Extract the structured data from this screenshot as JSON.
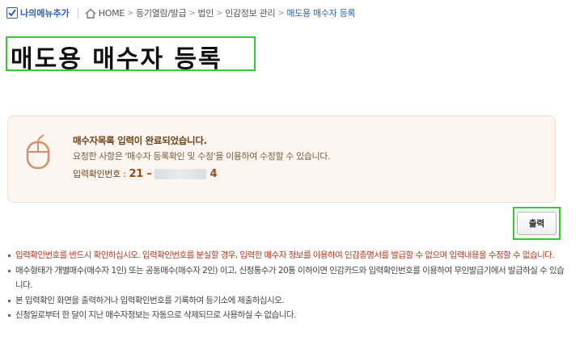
{
  "header": {
    "my_menu_label": "나의메뉴추가",
    "breadcrumb": [
      "HOME",
      "등기열람/발급",
      "법인",
      "인감정보 관리"
    ],
    "breadcrumb_current": "매도용 매수자 등록",
    "separator": ">"
  },
  "page": {
    "title": "매도용 매수자 등록"
  },
  "notice": {
    "headline": "매수자목록 입력이 완료되었습니다.",
    "desc": "요청한 사항은 '매수자 등록확인 및 수정'을 이용하여 수정할 수 있습니다.",
    "number_label": "입력확인번호 :",
    "number_prefix": "21 –",
    "number_suffix": "4"
  },
  "actions": {
    "print_label": "출력"
  },
  "bullets": [
    "입력확인번호를 반드시 확인하십시오. 입력확인번호를 분실할 경우, 입력한 매수자 정보를 이용하여 인감증명서를 발급할 수 없으며 입력내용을 수정할 수 없습니다.",
    "매수형태가 개별매수(매수자 1인) 또는 공동매수(매수자 2인) 이고, 신청통수가 20통 이하이면 인감카드와 입력확인번호를 이용하여 무인발급기에서 발급하실 수 있습니다.",
    "본 입력확인 화면을 출력하거나 입력확인번호를 기록하여 등기소에 제출하십시오.",
    "신청일로부터 한 달이 지난 매수자정보는 자동으로 삭제되므로 사용하실 수 없습니다."
  ],
  "colors": {
    "highlight_border": "#33cc33",
    "link_blue": "#2a63b8",
    "warning_red": "#b33a1e",
    "notice_bg": "#fdf6f0"
  }
}
